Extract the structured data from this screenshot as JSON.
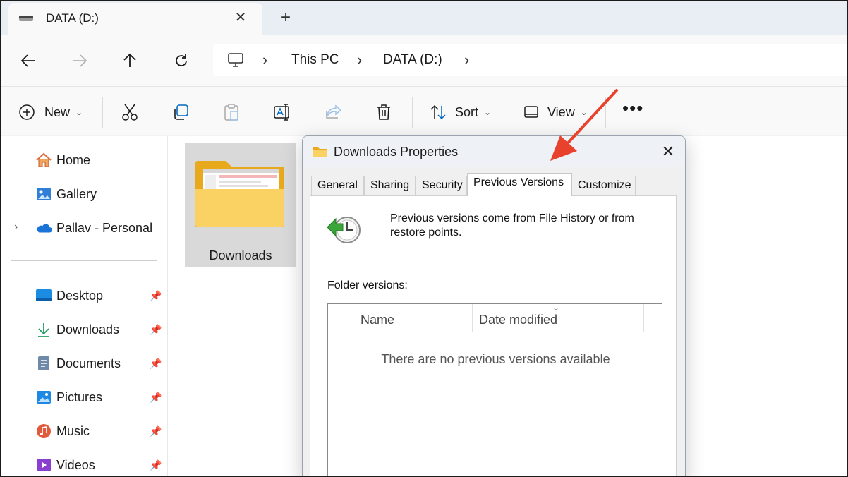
{
  "window": {
    "tab_title": "DATA (D:)",
    "tab_close_icon": "close-icon",
    "new_tab_icon": "plus-icon"
  },
  "navigation": {
    "back_icon": "arrow-left-icon",
    "forward_icon": "arrow-right-icon",
    "up_icon": "arrow-up-icon",
    "refresh_icon": "refresh-icon"
  },
  "address_bar": {
    "root_icon": "computer-icon",
    "breadcrumbs": [
      "This PC",
      "DATA (D:)"
    ]
  },
  "toolbar": {
    "new_label": "New",
    "sort_label": "Sort",
    "view_label": "View",
    "icons": [
      "plus-circle-icon",
      "cut-icon",
      "copy-icon",
      "paste-icon",
      "rename-icon",
      "share-icon",
      "delete-icon",
      "sort-icon",
      "view-icon",
      "more-icon"
    ]
  },
  "sidebar": {
    "top_items": [
      {
        "label": "Home",
        "icon": "home-icon"
      },
      {
        "label": "Gallery",
        "icon": "gallery-icon"
      },
      {
        "label": "Pallav - Personal",
        "icon": "onedrive-icon"
      }
    ],
    "pinned_items": [
      {
        "label": "Desktop",
        "icon": "desktop-icon"
      },
      {
        "label": "Downloads",
        "icon": "download-icon"
      },
      {
        "label": "Documents",
        "icon": "documents-icon"
      },
      {
        "label": "Pictures",
        "icon": "pictures-icon"
      },
      {
        "label": "Music",
        "icon": "music-icon"
      },
      {
        "label": "Videos",
        "icon": "videos-icon"
      }
    ]
  },
  "content": {
    "folder_tile_label": "Downloads"
  },
  "dialog": {
    "title": "Downloads Properties",
    "tabs": [
      "General",
      "Sharing",
      "Security",
      "Previous Versions",
      "Customize"
    ],
    "active_tab": "Previous Versions",
    "description": "Previous versions come from File History or from restore points.",
    "folder_versions_label": "Folder versions:",
    "columns": [
      "Name",
      "Date modified"
    ],
    "empty_message": "There are no previous versions available"
  },
  "colors": {
    "accent": "#0067c0",
    "annotation_arrow": "#e8412c",
    "folder_yellow": "#f7c744"
  }
}
